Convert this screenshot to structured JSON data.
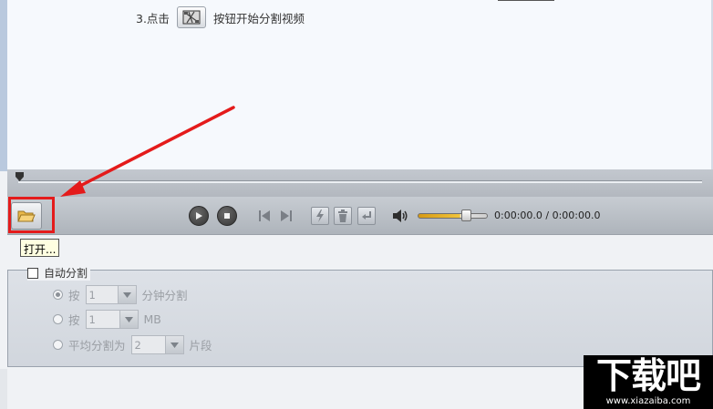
{
  "instructions": {
    "step3_prefix": "3.点击",
    "step3_suffix": "按钮开始分割视频",
    "step3_icon": "split-video-icon"
  },
  "player": {
    "open_icon": "folder-open-icon",
    "play_icon": "play-icon",
    "stop_icon": "stop-icon",
    "prev_icon": "skip-back-icon",
    "next_icon": "skip-forward-icon",
    "split_icon": "lightning-icon",
    "delete_icon": "trash-icon",
    "enter_icon": "return-icon",
    "volume_icon": "speaker-icon",
    "volume_level": 0.6,
    "time_display": "0:00:00.0 / 0:00:00.0"
  },
  "tooltip": {
    "text": "打开..."
  },
  "auto_split": {
    "label": "自动分割",
    "checked": false,
    "options": [
      {
        "prefix": "按",
        "value": "1",
        "suffix": "分钟分割",
        "selected": true
      },
      {
        "prefix": "按",
        "value": "1",
        "suffix": "MB",
        "selected": false
      },
      {
        "prefix": "平均分割为",
        "value": "2",
        "suffix": "片段",
        "selected": false
      }
    ]
  },
  "annotation": {
    "color": "#e41b1b"
  },
  "watermark": {
    "logo": "下载吧",
    "url": "www.xiazaiba.com"
  }
}
